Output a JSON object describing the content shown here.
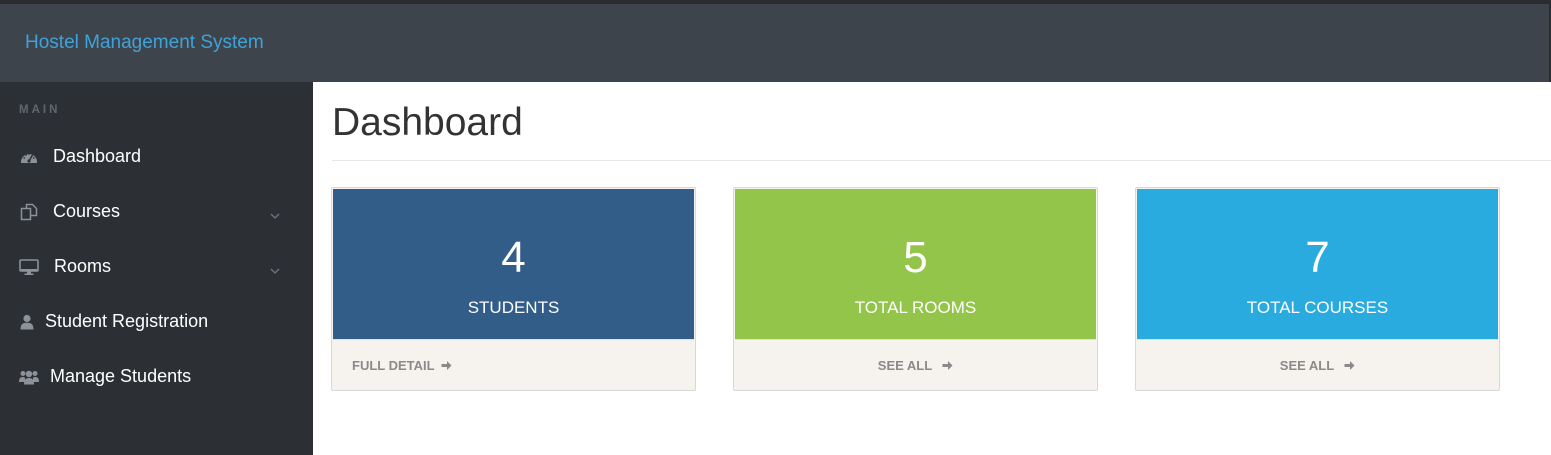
{
  "app": {
    "brand": "Hostel Management System"
  },
  "sidebar": {
    "heading": "MAIN",
    "items": [
      {
        "label": "Dashboard",
        "icon": "dashboard-icon",
        "has_submenu": false
      },
      {
        "label": "Courses",
        "icon": "copy-icon",
        "has_submenu": true
      },
      {
        "label": "Rooms",
        "icon": "desktop-icon",
        "has_submenu": true
      },
      {
        "label": "Student Registration",
        "icon": "user-icon",
        "has_submenu": false
      },
      {
        "label": "Manage Students",
        "icon": "users-icon",
        "has_submenu": false
      }
    ]
  },
  "main": {
    "title": "Dashboard",
    "cards": [
      {
        "count": "4",
        "label": "STUDENTS",
        "link": "FULL DETAIL",
        "color": "#325d88"
      },
      {
        "count": "5",
        "label": "TOTAL ROOMS",
        "link": "SEE ALL",
        "color": "#93c54b"
      },
      {
        "count": "7",
        "label": "TOTAL COURSES",
        "link": "SEE ALL",
        "color": "#29abe0"
      }
    ]
  },
  "colors": {
    "navbar": "#3d444c",
    "sidebar": "#2c3034",
    "brand_text": "#3fa3d9",
    "card_footer": "#f6f3ee"
  }
}
